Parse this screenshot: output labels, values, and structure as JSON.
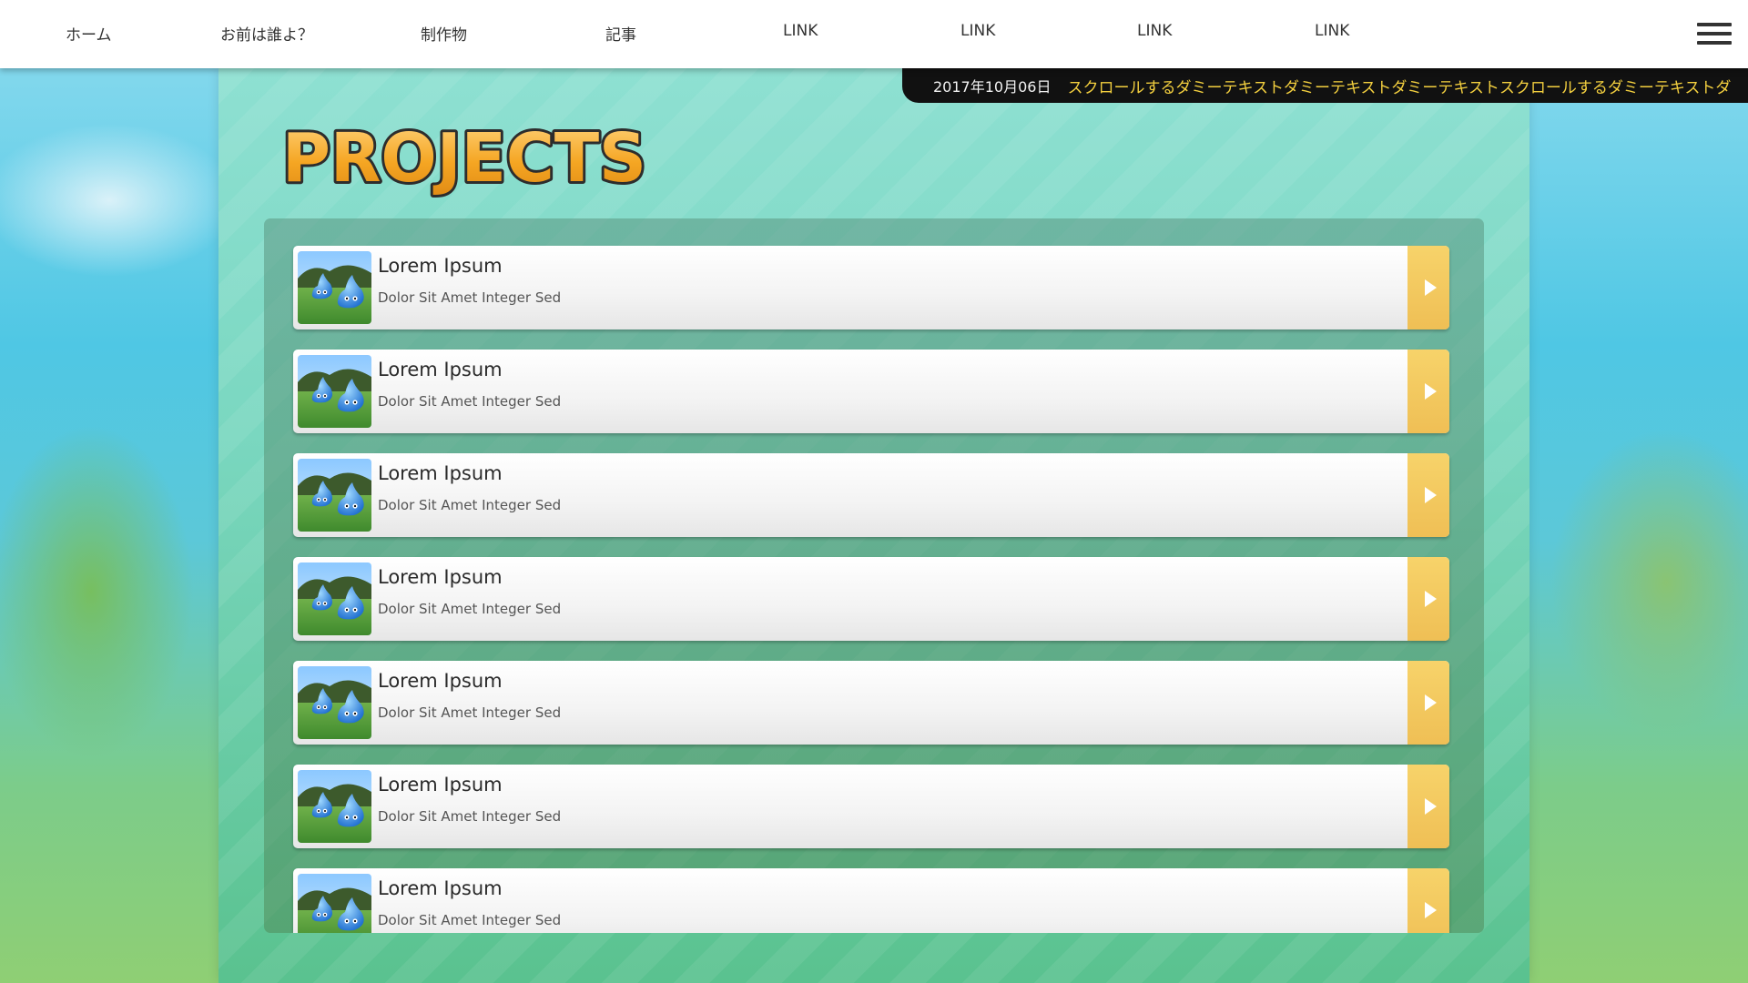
{
  "nav": {
    "items": [
      {
        "label": "ホーム"
      },
      {
        "label": "お前は誰よ？"
      },
      {
        "label": "制作物"
      },
      {
        "label": "記事"
      },
      {
        "label": "LINK"
      },
      {
        "label": "LINK"
      },
      {
        "label": "LINK"
      },
      {
        "label": "LINK"
      }
    ],
    "menu_icon": "hamburger-menu-icon"
  },
  "ticker": {
    "date": "2017年10月06日",
    "text": "スクロールするダミーテキストダミーテキストダミーテキストスクロールするダミーテキストダ"
  },
  "page": {
    "heading": "PROJECTS"
  },
  "projects": [
    {
      "title": "Lorem Ipsum",
      "subtitle": "Dolor Sit Amet Integer Sed"
    },
    {
      "title": "Lorem Ipsum",
      "subtitle": "Dolor Sit Amet Integer Sed"
    },
    {
      "title": "Lorem Ipsum",
      "subtitle": "Dolor Sit Amet Integer Sed"
    },
    {
      "title": "Lorem Ipsum",
      "subtitle": "Dolor Sit Amet Integer Sed"
    },
    {
      "title": "Lorem Ipsum",
      "subtitle": "Dolor Sit Amet Integer Sed"
    },
    {
      "title": "Lorem Ipsum",
      "subtitle": "Dolor Sit Amet Integer Sed"
    },
    {
      "title": "Lorem Ipsum",
      "subtitle": "Dolor Sit Amet Integer Sed"
    }
  ],
  "colors": {
    "ticker_text": "#f4d03f",
    "arrow_button": "#efbf55",
    "title_fill": "#f5a623"
  }
}
